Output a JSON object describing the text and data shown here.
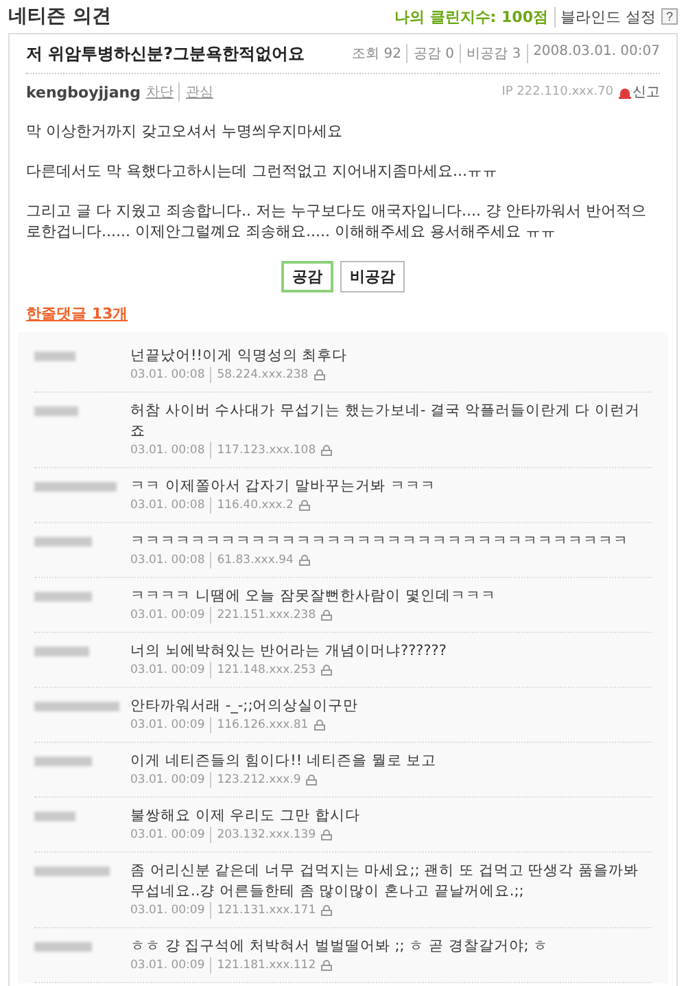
{
  "page_title": "네티즌 의견",
  "clean_score": "나의 클린지수: 100점",
  "blind_setting": "블라인드 설정",
  "help": "?",
  "post": {
    "title": "저 위암투병하신분?그분욕한적없어요",
    "stats": [
      "조회 92",
      "공감 0",
      "비공감 3",
      "2008.03.01. 00:07"
    ],
    "author": "kengboyjjang",
    "author_links": [
      "차단",
      "관심"
    ],
    "ip": "IP 222.110.xxx.70",
    "report": "신고",
    "paragraphs": [
      "막 이상한거까지 갖고오셔서 누명씌우지마세요",
      "다른데서도 막 욕했다고하시는데 그런적없고 지어내지좀마세요...ㅠㅠ",
      "그리고 글 다 지웠고 죄송합니다.. 저는 누구보다도 애국자입니다.... 걍 안타까워서 반어적으로한겁니다...... 이제안그럴꼐요 죄송해요..... 이해해주세요 용서해주세요 ㅠㅠ"
    ],
    "buttons": [
      {
        "label": "공감",
        "selected": true
      },
      {
        "label": "비공감",
        "selected": false
      }
    ]
  },
  "comments_heading": "한줄댓글 13개",
  "comments": [
    {
      "text": "넌끝났어!!이게 익명성의 최후다",
      "time": "03.01. 00:08",
      "ip": "58.224.xxx.238"
    },
    {
      "text": "허참 사이버 수사대가 무섭기는 했는가보네- 결국 악플러들이란게 다 이런거죠",
      "time": "03.01. 00:08",
      "ip": "117.123.xxx.108"
    },
    {
      "text": "ㅋㅋ 이제쫄아서 갑자기 말바꾸는거봐 ㅋㅋㅋ",
      "time": "03.01. 00:08",
      "ip": "116.40.xxx.2"
    },
    {
      "text": "ㅋㅋㅋㅋㅋㅋㅋㅋㅋㅋㅋㅋㅋㅋㅋㅋㅋㅋㅋㅋㅋㅋㅋㅋㅋㅋㅋㅋㅋㅋㅋㅋㅋ",
      "time": "03.01. 00:08",
      "ip": "61.83.xxx.94"
    },
    {
      "text": "ㅋㅋㅋㅋ 니땜에 오늘 잠못잘뻔한사람이 몇인데ㅋㅋㅋ",
      "time": "03.01. 00:09",
      "ip": "221.151.xxx.238"
    },
    {
      "text": "너의 뇌에박혀있는 반어라는 개념이머냐??????",
      "time": "03.01. 00:09",
      "ip": "121.148.xxx.253"
    },
    {
      "text": "안타까워서래 -_-;;어의상실이구만",
      "time": "03.01. 00:09",
      "ip": "116.126.xxx.81"
    },
    {
      "text": "이게 네티즌들의 힘이다!! 네티즌을 뭘로 보고",
      "time": "03.01. 00:09",
      "ip": "123.212.xxx.9"
    },
    {
      "text": "불쌍해요 이제 우리도 그만 합시다",
      "time": "03.01. 00:09",
      "ip": "203.132.xxx.139"
    },
    {
      "text": "좀 어리신분 같은데 너무 겁먹지는 마세요;; 괜히 또 겁먹고 딴생각 품을까봐 무섭네요..걍 어른들한테 좀 많이많이 혼나고 끝날꺼에요.;;",
      "time": "03.01. 00:09",
      "ip": "121.131.xxx.171"
    },
    {
      "text": "ㅎㅎ 걍 집구석에 처박혀서 벌벌떨어봐 ;; ㅎ 곧 경찰갈거야; ㅎ",
      "time": "03.01. 00:09",
      "ip": "121.181.xxx.112"
    }
  ]
}
